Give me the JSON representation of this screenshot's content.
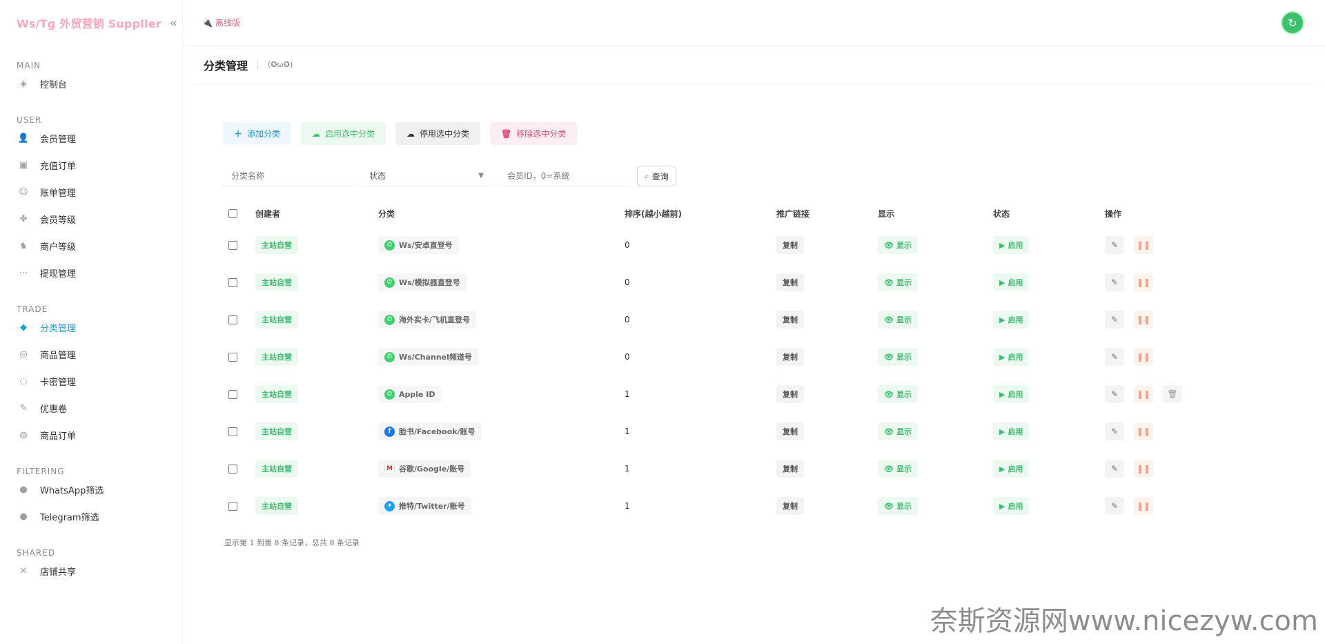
{
  "brand": {
    "title": "Ws/Tg 外贸营销 Supplier",
    "collapse_glyph": "«"
  },
  "topbar": {
    "offline_label": "离线版",
    "avatar_glyph": "↻"
  },
  "sidebar": {
    "sections": [
      {
        "heading": "MAIN",
        "items": [
          {
            "label": "控制台",
            "icon": "dashboard-icon",
            "glyph": "◈"
          }
        ]
      },
      {
        "heading": "USER",
        "items": [
          {
            "label": "会员管理",
            "icon": "user-icon",
            "glyph": "👤"
          },
          {
            "label": "充值订单",
            "icon": "recharge-icon",
            "glyph": "▣"
          },
          {
            "label": "账单管理",
            "icon": "bill-icon",
            "glyph": "☺"
          },
          {
            "label": "会员等级",
            "icon": "member-level-icon",
            "glyph": "✤"
          },
          {
            "label": "商户等级",
            "icon": "merchant-level-icon",
            "glyph": "♞"
          },
          {
            "label": "提现管理",
            "icon": "withdraw-icon",
            "glyph": "⋯"
          }
        ]
      },
      {
        "heading": "TRADE",
        "items": [
          {
            "label": "分类管理",
            "icon": "category-icon",
            "glyph": "◆",
            "active": true
          },
          {
            "label": "商品管理",
            "icon": "goods-icon",
            "glyph": "◎"
          },
          {
            "label": "卡密管理",
            "icon": "card-secret-icon",
            "glyph": "◌"
          },
          {
            "label": "优惠卷",
            "icon": "coupon-icon",
            "glyph": "✎"
          },
          {
            "label": "商品订单",
            "icon": "order-icon",
            "glyph": "◍"
          }
        ]
      },
      {
        "heading": "FILTERING",
        "items": [
          {
            "label": "WhatsApp筛选",
            "icon": "whatsapp-filter-icon",
            "glyph": "●"
          },
          {
            "label": "Telegram筛选",
            "icon": "telegram-filter-icon",
            "glyph": "●"
          }
        ]
      },
      {
        "heading": "SHARED",
        "items": [
          {
            "label": "店铺共享",
            "icon": "share-icon",
            "glyph": "✕"
          }
        ]
      }
    ]
  },
  "page": {
    "title": "分类管理",
    "subtitle": "(✪ω✪)"
  },
  "toolbar": {
    "add_label": "添加分类",
    "enable_label": "启用选中分类",
    "disable_label": "停用选中分类",
    "remove_label": "移除选中分类"
  },
  "filters": {
    "name_placeholder": "分类名称",
    "status_placeholder": "状态",
    "member_placeholder": "会员ID，0=系统",
    "search_label": "查询"
  },
  "table": {
    "headers": {
      "creator": "创建者",
      "category": "分类",
      "sort": "排序(越小越前)",
      "link": "推广链接",
      "show": "显示",
      "status": "状态",
      "ops": "操作"
    },
    "rows": [
      {
        "creator": "主站自营",
        "category": "Ws/安卓直登号",
        "cat_icon": "whatsapp",
        "sort": "0",
        "link": "复制",
        "show": "显示",
        "status": "启用",
        "deletable": false
      },
      {
        "creator": "主站自营",
        "category": "Ws/模拟器直登号",
        "cat_icon": "whatsapp",
        "sort": "0",
        "link": "复制",
        "show": "显示",
        "status": "启用",
        "deletable": false
      },
      {
        "creator": "主站自营",
        "category": "海外实卡/飞机直登号",
        "cat_icon": "whatsapp",
        "sort": "0",
        "link": "复制",
        "show": "显示",
        "status": "启用",
        "deletable": false
      },
      {
        "creator": "主站自营",
        "category": "Ws/Channel频道号",
        "cat_icon": "whatsapp",
        "sort": "0",
        "link": "复制",
        "show": "显示",
        "status": "启用",
        "deletable": false
      },
      {
        "creator": "主站自营",
        "category": "Apple ID",
        "cat_icon": "whatsapp",
        "sort": "1",
        "link": "复制",
        "show": "显示",
        "status": "启用",
        "deletable": true
      },
      {
        "creator": "主站自营",
        "category": "脸书/Facebook/账号",
        "cat_icon": "facebook",
        "sort": "1",
        "link": "复制",
        "show": "显示",
        "status": "启用",
        "deletable": false
      },
      {
        "creator": "主站自营",
        "category": "谷歌/Google/账号",
        "cat_icon": "google",
        "sort": "1",
        "link": "复制",
        "show": "显示",
        "status": "启用",
        "deletable": false
      },
      {
        "creator": "主站自营",
        "category": "推特/Twitter/账号",
        "cat_icon": "twitter",
        "sort": "1",
        "link": "复制",
        "show": "显示",
        "status": "启用",
        "deletable": false
      }
    ]
  },
  "footer": {
    "record_summary": "显示第 1 到第 8 条记录，总共 8 条记录"
  },
  "watermark": "奈斯资源网www.nicezyw.com",
  "colors": {
    "brand_pink": "#f7a6bd",
    "accent_blue": "#1aa3d8",
    "success_green": "#3bbf6d",
    "danger_pink": "#e24a78"
  }
}
